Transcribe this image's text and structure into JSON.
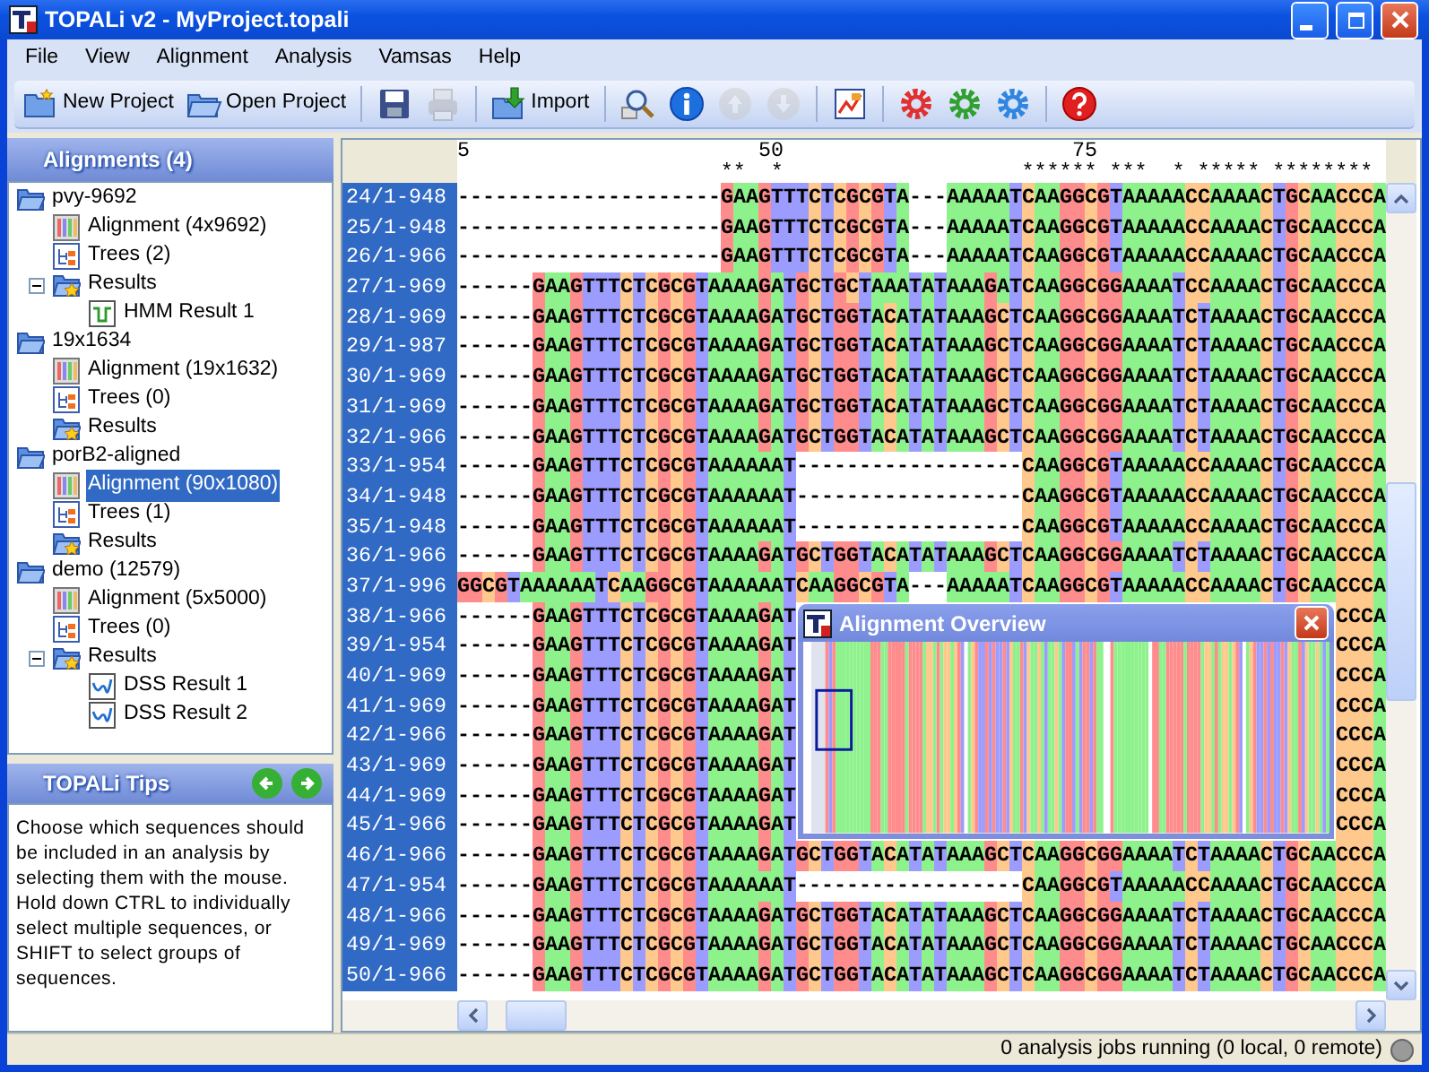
{
  "window": {
    "title": "TOPALi v2 - MyProject.topali"
  },
  "menu": [
    "File",
    "View",
    "Alignment",
    "Analysis",
    "Vamsas",
    "Help"
  ],
  "toolbar": [
    {
      "kind": "new",
      "label": "New Project",
      "disabled": false
    },
    {
      "kind": "open",
      "label": "Open Project",
      "disabled": false
    },
    {
      "kind": "separator"
    },
    {
      "kind": "save",
      "disabled": false
    },
    {
      "kind": "print",
      "disabled": true
    },
    {
      "kind": "separator"
    },
    {
      "kind": "import",
      "label": "Import",
      "disabled": false
    },
    {
      "kind": "separator"
    },
    {
      "kind": "search",
      "disabled": false
    },
    {
      "kind": "info",
      "disabled": false
    },
    {
      "kind": "up",
      "disabled": true
    },
    {
      "kind": "down",
      "disabled": true
    },
    {
      "kind": "separator"
    },
    {
      "kind": "chart",
      "disabled": false
    },
    {
      "kind": "separator"
    },
    {
      "kind": "gear",
      "color": "#e03030",
      "disabled": false
    },
    {
      "kind": "gear",
      "color": "#30a030",
      "disabled": false
    },
    {
      "kind": "gear",
      "color": "#2f86e0",
      "disabled": false
    },
    {
      "kind": "separator"
    },
    {
      "kind": "help",
      "disabled": false
    }
  ],
  "sidebar": {
    "title": "Alignments (4)",
    "tree": [
      {
        "kind": "folder",
        "label": "pvy-9692",
        "selected": false,
        "children": [
          {
            "kind": "alignment",
            "label": "Alignment (4x9692)",
            "selected": false
          },
          {
            "kind": "trees",
            "label": "Trees (2)",
            "selected": false
          },
          {
            "kind": "results",
            "label": "Results",
            "selected": false,
            "expanded": true,
            "children": [
              {
                "kind": "hmm",
                "label": "HMM Result 1",
                "selected": false
              }
            ]
          }
        ]
      },
      {
        "kind": "folder",
        "label": "19x1634",
        "selected": false,
        "children": [
          {
            "kind": "alignment",
            "label": "Alignment (19x1632)",
            "selected": false
          },
          {
            "kind": "trees",
            "label": "Trees (0)",
            "selected": false
          },
          {
            "kind": "results",
            "label": "Results",
            "selected": false
          }
        ]
      },
      {
        "kind": "folder",
        "label": "porB2-aligned",
        "selected": false,
        "children": [
          {
            "kind": "alignment",
            "label": "Alignment (90x1080)",
            "selected": true
          },
          {
            "kind": "trees",
            "label": "Trees (1)",
            "selected": false
          },
          {
            "kind": "results",
            "label": "Results",
            "selected": false
          }
        ]
      },
      {
        "kind": "folder",
        "label": "demo (12579)",
        "selected": false,
        "children": [
          {
            "kind": "alignment",
            "label": "Alignment (5x5000)",
            "selected": false
          },
          {
            "kind": "trees",
            "label": "Trees (0)",
            "selected": false
          },
          {
            "kind": "results",
            "label": "Results",
            "selected": false,
            "expanded": true,
            "children": [
              {
                "kind": "dss",
                "label": "DSS Result 1",
                "selected": false
              },
              {
                "kind": "dss",
                "label": "DSS Result 2",
                "selected": false
              }
            ]
          }
        ]
      }
    ]
  },
  "tips": {
    "title": "TOPALi Tips",
    "text": "Choose which sequences should be included in an analysis by selecting them with the mouse. Hold down CTRL to individually select multiple sequences, or SHIFT to select groups of sequences."
  },
  "alignment": {
    "ruler": [
      "5",
      "50",
      "75"
    ],
    "conservation": "                     **  *                   ****** ***  * ***** ******** ",
    "rows": [
      {
        "name": "24/1-948",
        "sequence": "---------------------GAAGTTTCTCGCGTA---AAAAATCAAGGCGTAAAAACCAAAACTGCAACCCA"
      },
      {
        "name": "25/1-948",
        "sequence": "---------------------GAAGTTTCTCGCGTA---AAAAATCAAGGCGTAAAAACCAAAACTGCAACCCA"
      },
      {
        "name": "26/1-966",
        "sequence": "---------------------GAAGTTTCTCGCGTA---AAAAATCAAGGCGTAAAAACCAAAACTGCAACCCA"
      },
      {
        "name": "27/1-969",
        "sequence": "------GAAGTTTCTCGCGTAAAAGATGCTGCTAAATATAAAGATCAAGGCGGAAAATCCAAAACTGCAACCCA"
      },
      {
        "name": "28/1-969",
        "sequence": "------GAAGTTTCTCGCGTAAAAGATGCTGGTACATATAAAGCTCAAGGCGGAAAATCTAAAACTGCAACCCA"
      },
      {
        "name": "29/1-987",
        "sequence": "------GAAGTTTCTCGCGTAAAAGATGCTGGTACATATAAAGCTCAAGGCGGAAAATCTAAAACTGCAACCCA"
      },
      {
        "name": "30/1-969",
        "sequence": "------GAAGTTTCTCGCGTAAAAGATGCTGGTACATATAAAGCTCAAGGCGGAAAATCTAAAACTGCAACCCA"
      },
      {
        "name": "31/1-969",
        "sequence": "------GAAGTTTCTCGCGTAAAAGATGCTGGTACATATAAAGCTCAAGGCGGAAAATCTAAAACTGCAACCCA"
      },
      {
        "name": "32/1-966",
        "sequence": "------GAAGTTTCTCGCGTAAAAGATGCTGGTACATATAAAGCTCAAGGCGGAAAATCTAAAACTGCAACCCA"
      },
      {
        "name": "33/1-954",
        "sequence": "------GAAGTTTCTCGCGTAAAAAAT------------------CAAGGCGTAAAAACCAAAACTGCAACCCA"
      },
      {
        "name": "34/1-948",
        "sequence": "------GAAGTTTCTCGCGTAAAAAAT------------------CAAGGCGTAAAAACCAAAACTGCAACCCA"
      },
      {
        "name": "35/1-948",
        "sequence": "------GAAGTTTCTCGCGTAAAAAAT------------------CAAGGCGTAAAAACCAAAACTGCAACCCA"
      },
      {
        "name": "36/1-966",
        "sequence": "------GAAGTTTCTCGCGTAAAAGATGCTGGTACATATAAAGCTCAAGGCGGAAAATCTAAAACTGCAACCCA"
      },
      {
        "name": "37/1-996",
        "sequence": "GGCGTAAAAAATCAAGGCGTAAAAAATCAAGGCGTA---AAAAATCAAGGCGTAAAAACCAAAACTGCAACCCA"
      },
      {
        "name": "38/1-966",
        "sequence_left": "------GAAGTTTCTCGCGTAAAAGAT",
        "sequence_right": "CCCA"
      },
      {
        "name": "39/1-954",
        "sequence_left": "------GAAGTTTCTCGCGTAAAAGAT",
        "sequence_right": "CCCA"
      },
      {
        "name": "40/1-969",
        "sequence_left": "------GAAGTTTCTCGCGTAAAAGAT",
        "sequence_right": "CCCA"
      },
      {
        "name": "41/1-969",
        "sequence_left": "------GAAGTTTCTCGCGTAAAAGAT",
        "sequence_right": "CCCA"
      },
      {
        "name": "42/1-966",
        "sequence_left": "------GAAGTTTCTCGCGTAAAAGAT",
        "sequence_right": "CCCA"
      },
      {
        "name": "43/1-969",
        "sequence_left": "------GAAGTTTCTCGCGTAAAAGAT",
        "sequence_right": "CCCA"
      },
      {
        "name": "44/1-969",
        "sequence_left": "------GAAGTTTCTCGCGTAAAAGAT",
        "sequence_right": "CCCA"
      },
      {
        "name": "45/1-966",
        "sequence_left": "------GAAGTTTCTCGCGTAAAAGAT",
        "sequence_right": "CCCA"
      },
      {
        "name": "46/1-966",
        "sequence": "------GAAGTTTCTCGCGTAAAAGATGCTGGTACATATAAAGCTCAAGGCGGAAAATCTAAAACTGCAACCCA"
      },
      {
        "name": "47/1-954",
        "sequence": "------GAAGTTTCTCGCGTAAAAAAT------------------CAAGGCGTAAAAACCAAAACTGCAACCCA"
      },
      {
        "name": "48/1-966",
        "sequence": "------GAAGTTTCTCGCGTAAAAGATGCTGGTACATATAAAGCTCAAGGCGGAAAATCTAAAACTGCAACCCA"
      },
      {
        "name": "49/1-969",
        "sequence": "------GAAGTTTCTCGCGTAAAAGATGCTGGTACATATAAAGCTCAAGGCGGAAAATCTAAAACTGCAACCCA"
      },
      {
        "name": "50/1-966",
        "sequence": "------GAAGTTTCTCGCGTAAAAGATGCTGGTACATATAAAGCTCAAGGCGGAAAATCTAAAACTGCAACCCA"
      }
    ]
  },
  "overview": {
    "title": "Alignment Overview"
  },
  "status_bar": {
    "text": "0 analysis jobs running (0 local, 0 remote)"
  }
}
